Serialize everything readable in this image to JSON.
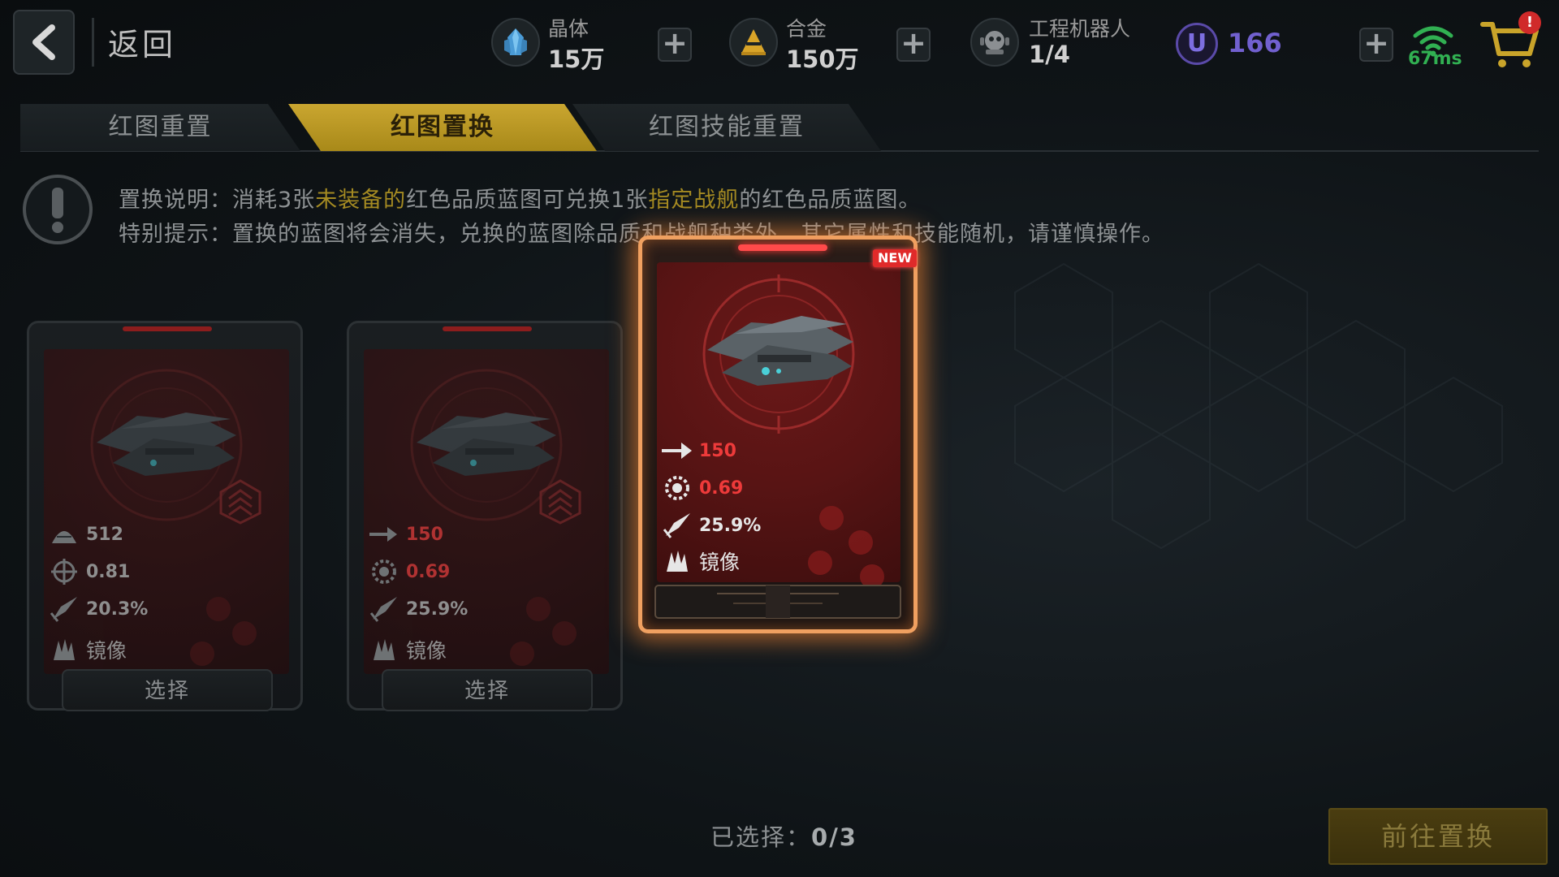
{
  "header": {
    "back_label": "返回",
    "resources": [
      {
        "label": "晶体",
        "value": "15万",
        "icon": "crystal-icon"
      },
      {
        "label": "合金",
        "value": "150万",
        "icon": "alloy-icon"
      },
      {
        "label": "工程机器人",
        "value": "1/4",
        "icon": "robot-icon"
      }
    ],
    "ucoin_symbol": "U",
    "ucoin_value": "166",
    "ping": "67ms",
    "cart_badge": "!"
  },
  "tabs": [
    {
      "label": "红图重置",
      "active": false
    },
    {
      "label": "红图置换",
      "active": true
    },
    {
      "label": "红图技能重置",
      "active": false
    }
  ],
  "info": {
    "line1_prefix": "置换说明：消耗3张",
    "line1_hl1": "未装备的",
    "line1_mid": "红色品质蓝图可兑换1张",
    "line1_hl2": "指定战舰",
    "line1_suffix": "的红色品质蓝图。",
    "line2": "特别提示：置换的蓝图将会消失，兑换的蓝图除品质和战舰种类外，其它属性和技能随机，请谨慎操作。"
  },
  "cards": [
    {
      "stats": [
        {
          "icon": "armor-icon",
          "value": "512"
        },
        {
          "icon": "crosshair-icon",
          "value": "0.81"
        },
        {
          "icon": "missile-icon",
          "value": "20.3%"
        },
        {
          "icon": "skill-icon",
          "value": "镜像"
        }
      ],
      "select_label": "选择"
    },
    {
      "stats": [
        {
          "icon": "speed-arrow-icon",
          "value": "150"
        },
        {
          "icon": "gear-icon",
          "value": "0.69"
        },
        {
          "icon": "missile-icon",
          "value": "25.9%"
        },
        {
          "icon": "skill-icon",
          "value": "镜像"
        }
      ],
      "select_label": "选择"
    }
  ],
  "featured": {
    "badge": "NEW",
    "stats": [
      {
        "icon": "speed-arrow-icon",
        "value": "150"
      },
      {
        "icon": "gear-icon",
        "value": "0.69"
      },
      {
        "icon": "missile-icon",
        "value": "25.9%"
      },
      {
        "icon": "skill-icon",
        "value": "镜像"
      }
    ]
  },
  "footer": {
    "selected_label": "已选择：",
    "selected_value": "0/3",
    "go_button": "前往置换"
  },
  "colors": {
    "accent_gold": "#caa630",
    "stat_red": "#ee3a3a",
    "glow_orange": "#f0a060",
    "ping_green": "#31b052",
    "ucoin_purple": "#7160cf"
  }
}
